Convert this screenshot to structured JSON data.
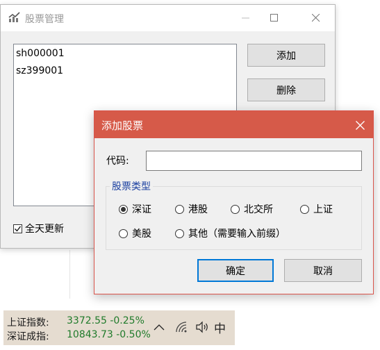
{
  "main_window": {
    "title": "股票管理",
    "stocks": [
      "sh000001",
      "sz399001"
    ],
    "add_label": "添加",
    "delete_label": "删除",
    "refresh_all_day_label": "全天更新",
    "refresh_all_day_checked": true
  },
  "dialog": {
    "title": "添加股票",
    "code_label": "代码:",
    "code_value": "",
    "type_group_title": "股票类型",
    "types": [
      {
        "label": "深证",
        "checked": true
      },
      {
        "label": "港股",
        "checked": false
      },
      {
        "label": "北交所",
        "checked": false
      },
      {
        "label": "上证",
        "checked": false
      },
      {
        "label": "美股",
        "checked": false
      },
      {
        "label": "其他（需要输入前缀）",
        "checked": false
      }
    ],
    "ok_label": "确定",
    "cancel_label": "取消",
    "accent_color": "#d65a49"
  },
  "taskbar": {
    "tickers": [
      {
        "name": "上证指数:",
        "value": "3372.55 -0.25%"
      },
      {
        "name": "深证成指:",
        "value": "10843.73 -0.50%"
      }
    ],
    "ime_label": "中"
  }
}
